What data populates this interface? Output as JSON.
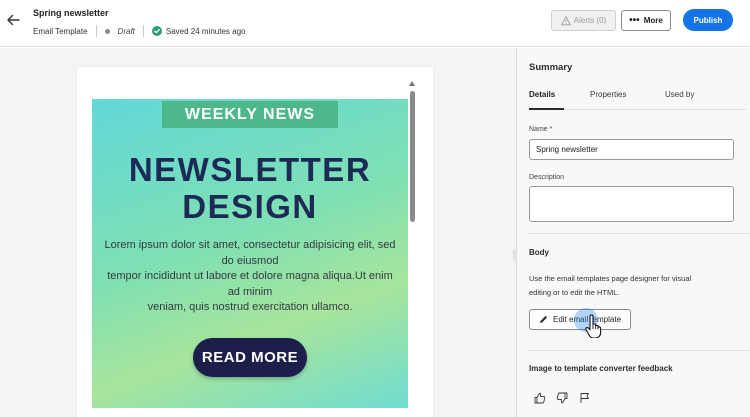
{
  "header": {
    "title": "Spring newsletter",
    "type": "Email Template",
    "status": "Draft",
    "saved": "Saved 24 minutes ago",
    "alerts_label": "Alerts (0)",
    "more_label": "More",
    "publish_label": "Publish"
  },
  "newsletter": {
    "badge": "WEEKLY NEWS",
    "heading_line1": "NEWSLETTER",
    "heading_line2": "DESIGN",
    "body_line1": "Lorem ipsum dolor sit amet, consectetur adipisicing elit, sed",
    "body_line2": "do eiusmod",
    "body_line3": "tempor incididunt ut labore et dolore magna aliqua.Ut enim",
    "body_line4": "ad minim",
    "body_line5": "veniam, quis nostrud exercitation ullamco.",
    "cta": "READ MORE"
  },
  "panel": {
    "title": "Summary",
    "tabs": [
      {
        "label": "Details",
        "active": true
      },
      {
        "label": "Properties",
        "active": false
      },
      {
        "label": "Used by",
        "active": false
      }
    ],
    "name_label": "Name",
    "required_mark": "*",
    "name_value": "Spring newsletter",
    "description_label": "Description",
    "description_value": "",
    "body_title": "Body",
    "body_text_line1": "Use the email templates page designer for visual",
    "body_text_line2": "editing or to edit the HTML.",
    "edit_button": "Edit email template",
    "feedback_title": "Image to template converter feedback"
  },
  "colors": {
    "accent": "#1473e6",
    "badge_bg": "#4fb88a",
    "heading": "#1d2a55",
    "cta_bg": "#1c1f4a",
    "success": "#2d9d78"
  },
  "icons": [
    "arrow-left-icon",
    "checkmark-circle-icon",
    "alert-icon",
    "more-icon",
    "pencil-icon",
    "thumbs-up-icon",
    "thumbs-down-icon",
    "flag-icon",
    "hand-cursor-icon"
  ]
}
